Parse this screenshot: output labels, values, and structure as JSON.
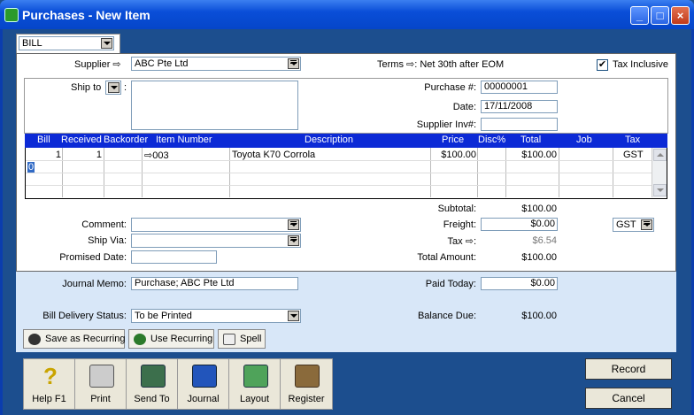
{
  "window": {
    "title": "Purchases - New Item",
    "controls": [
      "_",
      "□",
      "×"
    ]
  },
  "tab": {
    "type": "BILL"
  },
  "supplier": {
    "label": "Supplier",
    "value": "ABC Pte Ltd"
  },
  "terms": {
    "label": "Terms",
    "value": "Net 30th after EOM"
  },
  "tax_inclusive": {
    "label": "Tax Inclusive",
    "checked": true
  },
  "ship_to": {
    "label": "Ship to",
    "value": ""
  },
  "purchase_no": {
    "label": "Purchase #:",
    "value": "00000001"
  },
  "date": {
    "label": "Date:",
    "value": "17/11/2008"
  },
  "supplier_inv": {
    "label": "Supplier Inv#:",
    "value": ""
  },
  "grid": {
    "columns": [
      "Bill",
      "Received",
      "Backorder",
      "Item Number",
      "Description",
      "Price",
      "Disc%",
      "Total",
      "Job",
      "Tax"
    ],
    "rows": [
      {
        "bill": "1",
        "received": "1",
        "backorder": "",
        "item_number": "003",
        "description": "Toyota K70 Corrola",
        "price": "$100.00",
        "disc": "",
        "total": "$100.00",
        "job": "",
        "tax": "GST"
      }
    ],
    "new_row_bill": "0"
  },
  "totals": {
    "subtotal_label": "Subtotal:",
    "subtotal": "$100.00",
    "freight_label": "Freight:",
    "freight": "$0.00",
    "freight_tax": "GST",
    "tax_label": "Tax",
    "tax": "$6.54",
    "total_label": "Total Amount:",
    "total": "$100.00"
  },
  "comment": {
    "label": "Comment:",
    "value": ""
  },
  "ship_via": {
    "label": "Ship Via:",
    "value": ""
  },
  "promised_date": {
    "label": "Promised Date:",
    "value": ""
  },
  "journal_memo": {
    "label": "Journal Memo:",
    "value": "Purchase; ABC Pte Ltd"
  },
  "paid_today": {
    "label": "Paid Today:",
    "value": "$0.00"
  },
  "delivery_status": {
    "label": "Bill Delivery Status:",
    "value": "To be Printed"
  },
  "balance_due": {
    "label": "Balance Due:",
    "value": "$100.00"
  },
  "actions": {
    "save_recurring": "Save as Recurring",
    "use_recurring": "Use Recurring",
    "spell": "Spell"
  },
  "toolbar": {
    "help": "Help F1",
    "print": "Print",
    "send_to": "Send To",
    "journal": "Journal",
    "layout": "Layout",
    "register": "Register"
  },
  "buttons": {
    "record": "Record",
    "cancel": "Cancel"
  },
  "colors": {
    "title_bar": "#0a4ed8",
    "grid_header": "#0c2ad6",
    "lower_panel": "#d8e7f8",
    "frame": "#1c4e8e"
  }
}
